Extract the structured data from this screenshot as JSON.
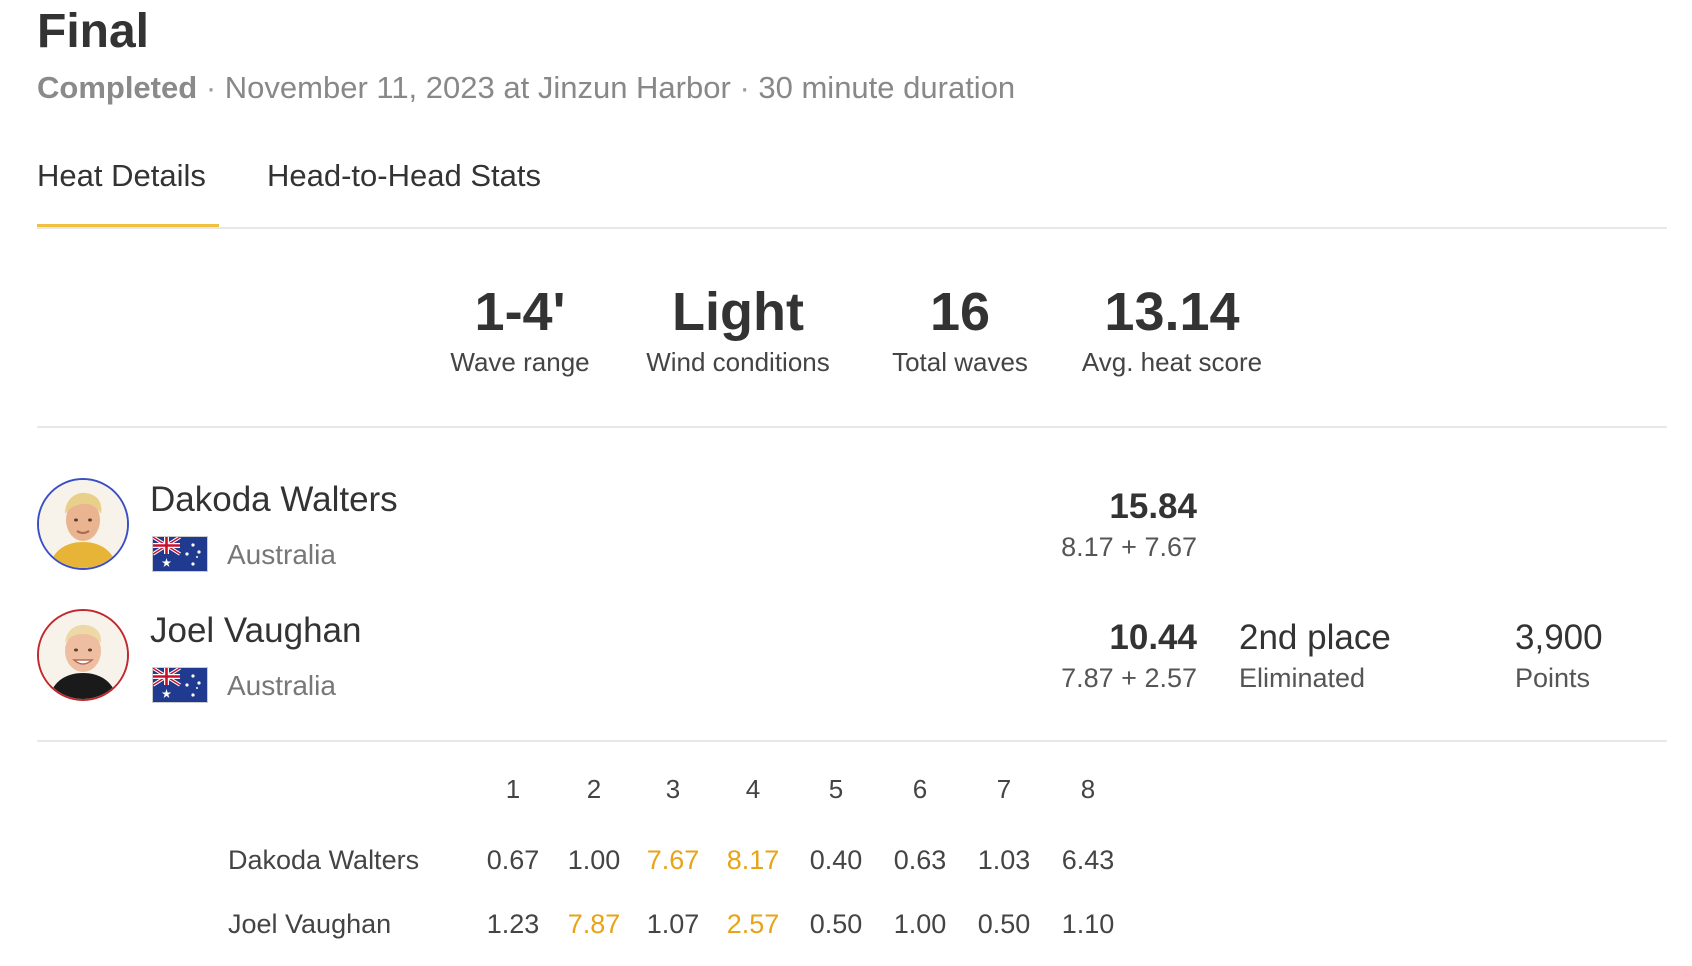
{
  "heat": {
    "title": "Final",
    "status": "Completed",
    "date_location": "November 11, 2023 at Jinzun Harbor",
    "duration": "30 minute duration",
    "separator": "·"
  },
  "tabs": [
    {
      "label": "Heat Details",
      "active": true
    },
    {
      "label": "Head-to-Head Stats",
      "active": false
    }
  ],
  "accent_color": "#f0c040",
  "highlight_color": "#e8a317",
  "stats": [
    {
      "value": "1-4'",
      "label": "Wave range"
    },
    {
      "value": "Light",
      "label": "Wind conditions"
    },
    {
      "value": "16",
      "label": "Total waves"
    },
    {
      "value": "13.14",
      "label": "Avg. heat score"
    }
  ],
  "surfers": [
    {
      "name": "Dakoda Walters",
      "country": "Australia",
      "flag": "australia-flag",
      "ring_color": "#3b4fc4",
      "total": "15.84",
      "breakdown": "8.17 + 7.67",
      "place": "",
      "place_sub": "",
      "points": "",
      "points_sub": ""
    },
    {
      "name": "Joel Vaughan",
      "country": "Australia",
      "flag": "australia-flag",
      "ring_color": "#c0282d",
      "total": "10.44",
      "breakdown": "7.87 + 2.57",
      "place": "2nd place",
      "place_sub": "Eliminated",
      "points": "3,900",
      "points_sub": "Points"
    }
  ],
  "waves": {
    "headers": [
      "1",
      "2",
      "3",
      "4",
      "5",
      "6",
      "7",
      "8"
    ],
    "rows": [
      {
        "name": "Dakoda Walters",
        "scores": [
          "0.67",
          "1.00",
          "7.67",
          "8.17",
          "0.40",
          "0.63",
          "1.03",
          "6.43"
        ],
        "counting": [
          false,
          false,
          true,
          true,
          false,
          false,
          false,
          false
        ]
      },
      {
        "name": "Joel Vaughan",
        "scores": [
          "1.23",
          "7.87",
          "1.07",
          "2.57",
          "0.50",
          "1.00",
          "0.50",
          "1.10"
        ],
        "counting": [
          false,
          true,
          false,
          true,
          false,
          false,
          false,
          false
        ]
      }
    ]
  }
}
